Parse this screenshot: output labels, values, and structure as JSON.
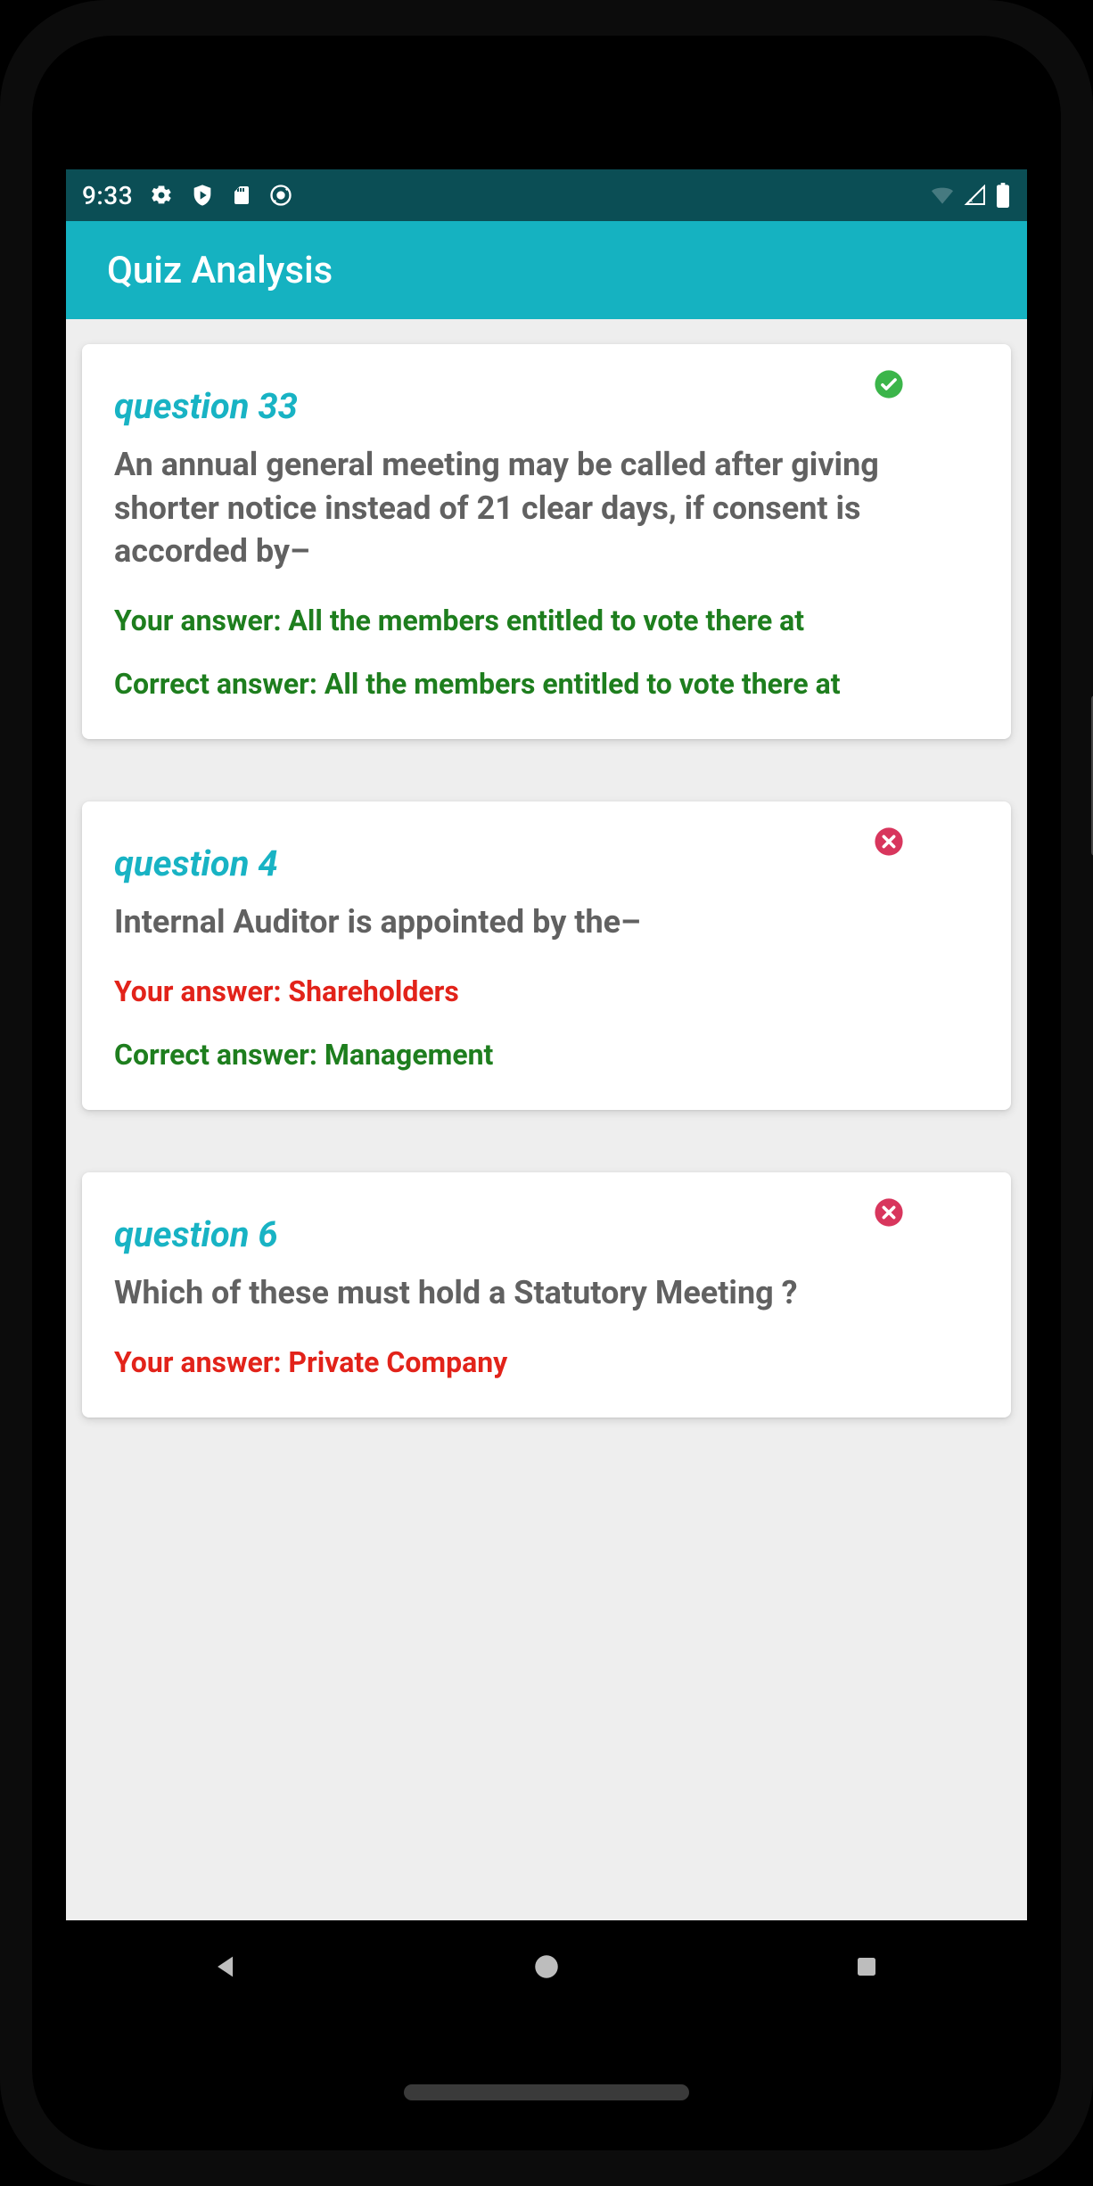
{
  "status": {
    "time": "9:33"
  },
  "appbar": {
    "title": "Quiz Analysis"
  },
  "labels": {
    "your_answer": "Your answer: ",
    "correct_answer": "Correct answer: "
  },
  "colors": {
    "correct": "#1e7e1e",
    "wrong": "#e2231a",
    "accent": "#15b2c1"
  },
  "questions": [
    {
      "label": "question 33",
      "text": "An annual general meeting may be called after giving shorter notice instead of 21 clear days, if consent is accorded by–",
      "your_answer": "All the members entitled to vote there at",
      "correct_answer": "All the members entitled to vote there at",
      "is_correct": true
    },
    {
      "label": "question 4",
      "text": "Internal Auditor is appointed by the–",
      "your_answer": "Shareholders",
      "correct_answer": "Management",
      "is_correct": false
    },
    {
      "label": "question 6",
      "text": "Which of these must hold a Statutory Meeting ?",
      "your_answer": "Private Company",
      "correct_answer": "",
      "is_correct": false
    }
  ]
}
